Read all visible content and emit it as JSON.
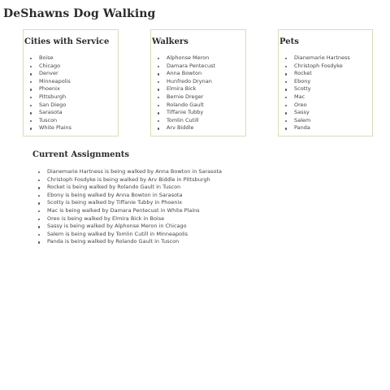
{
  "page": {
    "title": "DeShawns Dog Walking"
  },
  "cities": {
    "heading": "Cities with Service",
    "items": [
      "Boise",
      "Chicago",
      "Denver",
      "Minneapolis",
      "Phoenix",
      "Pittsburgh",
      "San Diego",
      "Sarasota",
      "Tuscon",
      "White Plains"
    ]
  },
  "walkers": {
    "heading": "Walkers",
    "items": [
      "Alphonse Meron",
      "Damara Pentecust",
      "Anna Bowton",
      "Hunfredo Drynan",
      "Elmira Bick",
      "Bernie Dreger",
      "Rolando Gault",
      "Tiffanie Tubby",
      "Tomlin Cutill",
      "Arv Biddle"
    ]
  },
  "pets": {
    "heading": "Pets",
    "items": [
      "Dianemarie Hartness",
      "Christoph Fosdyke",
      "Rocket",
      "Ebony",
      "Scotty",
      "Mac",
      "Oreo",
      "Sassy",
      "Salem",
      "Panda"
    ]
  },
  "assignments": {
    "heading": "Current Assignments",
    "items": [
      "Dianemarie Hartness is being walked by Anna Bowton in Sarasota",
      "Christoph Fosdyke is being walked by Arv Biddle in Pittsburgh",
      "Rocket is being walked by Rolando Gault in Tuscon",
      "Ebony is being walked by Anna Bowton in Sarasota",
      "Scotty is being walked by Tiffanie Tubby in Phoenix",
      "Mac is being walked by Damara Pentecust in White Plains",
      "Oreo is being walked by Elmira Bick in Boise",
      "Sassy is being walked by Alphonse Meron in Chicago",
      "Salem is being walked by Tomlin Cutill in Minneapolis",
      "Panda is being walked by Rolando Gault in Tuscon"
    ]
  },
  "colors": {
    "card_border": "#d9dcb7",
    "text": "#444444",
    "heading": "#2b2b2b"
  }
}
